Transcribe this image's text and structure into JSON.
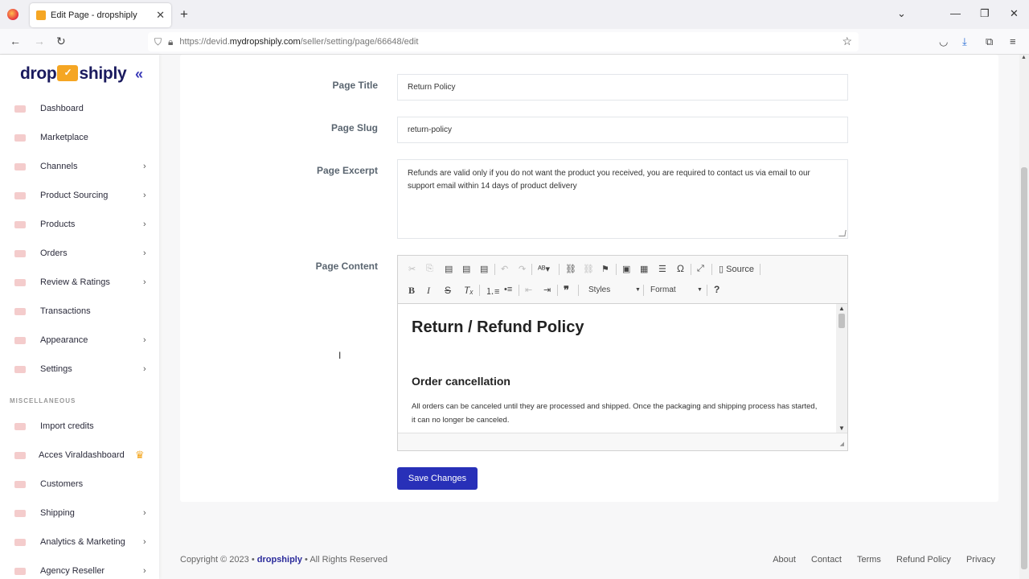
{
  "browser": {
    "tab_title": "Edit Page - dropshiply",
    "tab_close": "✕",
    "new_tab": "+",
    "url_prefix": "https://devid.",
    "url_host": "mydropshiply.com",
    "url_path": "/seller/setting/page/66648/edit",
    "window_controls": [
      "⌄",
      "—",
      "❐",
      "✕"
    ]
  },
  "sidebar": {
    "logo_left": "drop",
    "logo_right": "shiply",
    "collapse": "«",
    "items": [
      {
        "label": "Dashboard",
        "chevron": ""
      },
      {
        "label": "Marketplace",
        "chevron": ""
      },
      {
        "label": "Channels",
        "chevron": "›"
      },
      {
        "label": "Product Sourcing",
        "chevron": "›"
      },
      {
        "label": "Products",
        "chevron": "›"
      },
      {
        "label": "Orders",
        "chevron": "›"
      },
      {
        "label": "Review & Ratings",
        "chevron": "›"
      },
      {
        "label": "Transactions",
        "chevron": ""
      },
      {
        "label": "Appearance",
        "chevron": "›"
      },
      {
        "label": "Settings",
        "chevron": "›"
      }
    ],
    "section_label": "MISCELLANEOUS",
    "misc_items": [
      {
        "label": "Import credits",
        "chevron": ""
      },
      {
        "label": "Acces Viraldashboard",
        "chevron": ""
      },
      {
        "label": "Customers",
        "chevron": ""
      },
      {
        "label": "Shipping",
        "chevron": "›"
      },
      {
        "label": "Analytics & Marketing",
        "chevron": "›"
      },
      {
        "label": "Agency Reseller",
        "chevron": "›"
      }
    ],
    "crown_icon": "♛"
  },
  "form": {
    "title_label": "Page Title",
    "title_value": "Return Policy",
    "slug_label": "Page Slug",
    "slug_value": "return-policy",
    "excerpt_label": "Page Excerpt",
    "excerpt_value": " Refunds are valid only if you do not want the product you received, you are required to contact us via email to our support email within 14 days of product delivery",
    "content_label": "Page Content",
    "save_label": "Save Changes"
  },
  "editor": {
    "source_label": "Source",
    "styles_label": "Styles",
    "format_label": "Format",
    "help": "?",
    "heading": "Return / Refund Policy",
    "subheading": "Order cancellation",
    "paragraph": "All orders can be canceled until they are processed and shipped. Once the packaging and shipping process has started, it can no longer be canceled."
  },
  "footer": {
    "copyright": "Copyright © 2023 •",
    "brand": "dropshiply",
    "rights": "• All Rights Reserved",
    "links": [
      "About",
      "Contact",
      "Terms",
      "Refund Policy",
      "Privacy"
    ]
  }
}
